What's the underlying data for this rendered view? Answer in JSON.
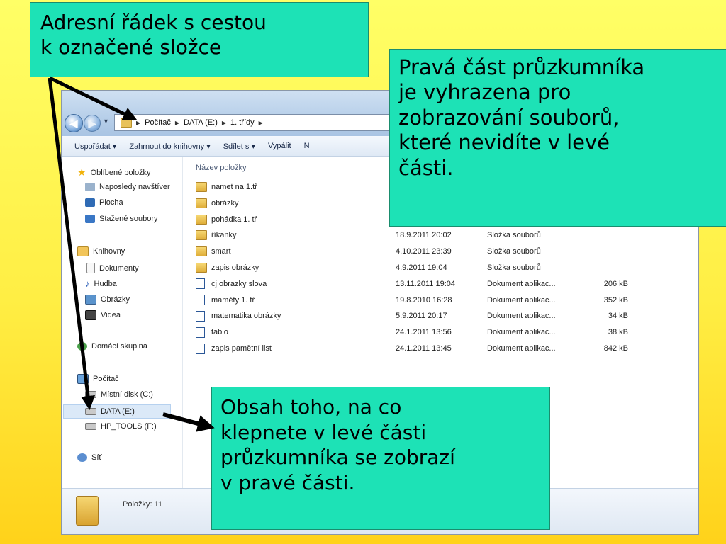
{
  "address_bar": {
    "crumbs": [
      "Počítač",
      "DATA (E:)",
      "1. třídy"
    ]
  },
  "toolbar": {
    "items": [
      "Uspořádat ▾",
      "Zahrnout do knihovny ▾",
      "Sdílet s ▾",
      "Vypálit",
      "N"
    ]
  },
  "nav_pane": {
    "items": [
      {
        "label": "Oblíbené položky",
        "icon": "star-icon"
      },
      {
        "label": "Naposledy navštíver",
        "icon": "recent-places-icon"
      },
      {
        "label": "Plocha",
        "icon": "desktop-icon"
      },
      {
        "label": "Stažené soubory",
        "icon": "downloads-icon"
      },
      {
        "label": "Knihovny",
        "icon": "libraries-icon"
      },
      {
        "label": "Dokumenty",
        "icon": "documents-icon"
      },
      {
        "label": "Hudba",
        "icon": "music-icon"
      },
      {
        "label": "Obrázky",
        "icon": "pictures-icon"
      },
      {
        "label": "Videa",
        "icon": "videos-icon"
      },
      {
        "label": "Domácí skupina",
        "icon": "homegroup-icon"
      },
      {
        "label": "Počítač",
        "icon": "computer-icon"
      },
      {
        "label": "Místní disk (C:)",
        "icon": "local-disk-icon"
      },
      {
        "label": "DATA (E:)",
        "icon": "drive-icon"
      },
      {
        "label": "HP_TOOLS (F:)",
        "icon": "drive-icon"
      },
      {
        "label": "Síť",
        "icon": "network-icon"
      }
    ]
  },
  "file_list": {
    "column_header": "Název položky",
    "rows": [
      {
        "name": "namet na 1.tř",
        "date": "",
        "type": "",
        "size": "",
        "kind": "folder"
      },
      {
        "name": "obrázky",
        "date": "",
        "type": "",
        "size": "",
        "kind": "folder"
      },
      {
        "name": "pohádka 1. tř",
        "date": "",
        "type": "",
        "size": "",
        "kind": "folder"
      },
      {
        "name": "říkanky",
        "date": "18.9.2011 20:02",
        "type": "Složka souborů",
        "size": "",
        "kind": "folder"
      },
      {
        "name": "smart",
        "date": "4.10.2011 23:39",
        "type": "Složka souborů",
        "size": "",
        "kind": "folder"
      },
      {
        "name": "zapis obrázky",
        "date": "4.9.2011 19:04",
        "type": "Složka souborů",
        "size": "",
        "kind": "folder"
      },
      {
        "name": "cj obrazky slova",
        "date": "13.11.2011 19:04",
        "type": "Dokument aplikac...",
        "size": "206 kB",
        "kind": "doc"
      },
      {
        "name": "maměty 1. tř",
        "date": "19.8.2010 16:28",
        "type": "Dokument aplikac...",
        "size": "352 kB",
        "kind": "doc"
      },
      {
        "name": "matematika obrázky",
        "date": "5.9.2011 20:17",
        "type": "Dokument aplikac...",
        "size": "34 kB",
        "kind": "doc"
      },
      {
        "name": "tablo",
        "date": "24.1.2011 13:56",
        "type": "Dokument aplikac...",
        "size": "38 kB",
        "kind": "doc"
      },
      {
        "name": "zapis pamětní list",
        "date": "24.1.2011 13:45",
        "type": "Dokument aplikac...",
        "size": "842 kB",
        "kind": "doc"
      }
    ]
  },
  "status_bar": {
    "count": "Položky: 11"
  },
  "callouts": {
    "address": [
      "Adresní řádek s cestou",
      "k označené složce"
    ],
    "right_part": [
      "Pravá část průzkumníka",
      "je vyhrazena pro",
      "zobrazování souborů,",
      "které nevidíte v levé",
      "části."
    ],
    "content": [
      "Obsah toho, na co",
      "klepnete v levé části",
      "průzkumníka se zobrazí",
      "v pravé části."
    ]
  },
  "colors": {
    "callout_fill": "#1de2b6",
    "background_top": "#ffff66",
    "background_bottom": "#ffd21a"
  }
}
